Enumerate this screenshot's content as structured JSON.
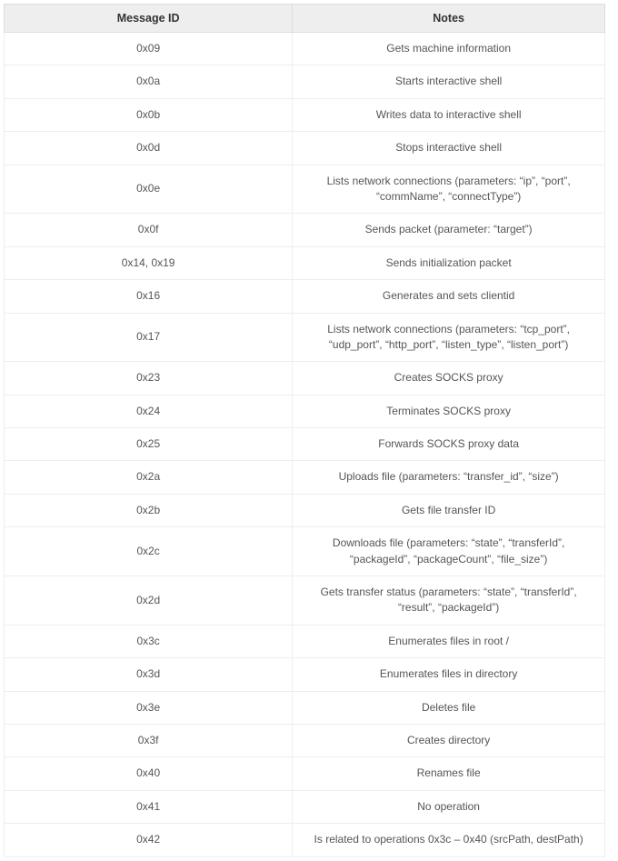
{
  "table": {
    "headers": {
      "id": "Message ID",
      "notes": "Notes"
    },
    "rows": [
      {
        "id": "0x09",
        "notes": "Gets machine information"
      },
      {
        "id": "0x0a",
        "notes": "Starts interactive shell"
      },
      {
        "id": "0x0b",
        "notes": "Writes data to interactive shell"
      },
      {
        "id": "0x0d",
        "notes": "Stops interactive shell"
      },
      {
        "id": "0x0e",
        "notes": "Lists network connections (parameters: “ip”, “port”, “commName”, “connectType”)"
      },
      {
        "id": "0x0f",
        "notes": "Sends packet (parameter: “target”)"
      },
      {
        "id": "0x14, 0x19",
        "notes": "Sends initialization packet"
      },
      {
        "id": "0x16",
        "notes": "Generates and sets clientid"
      },
      {
        "id": "0x17",
        "notes": "Lists network connections (parameters: “tcp_port”, “udp_port”, “http_port”, “listen_type”, “listen_port”)"
      },
      {
        "id": "0x23",
        "notes": "Creates SOCKS proxy"
      },
      {
        "id": "0x24",
        "notes": "Terminates SOCKS proxy"
      },
      {
        "id": "0x25",
        "notes": "Forwards SOCKS proxy data"
      },
      {
        "id": "0x2a",
        "notes": "Uploads file (parameters: “transfer_id”, “size”)"
      },
      {
        "id": "0x2b",
        "notes": "Gets file transfer ID"
      },
      {
        "id": "0x2c",
        "notes": "Downloads file (parameters: “state”, “transferId”, “packageId”, “packageCount”, “file_size”)"
      },
      {
        "id": "0x2d",
        "notes": "Gets transfer status (parameters: “state”, “transferId”, “result”, “packageId”)"
      },
      {
        "id": "0x3c",
        "notes": "Enumerates files in root /"
      },
      {
        "id": "0x3d",
        "notes": "Enumerates files in directory"
      },
      {
        "id": "0x3e",
        "notes": "Deletes file"
      },
      {
        "id": "0x3f",
        "notes": "Creates directory"
      },
      {
        "id": "0x40",
        "notes": "Renames file"
      },
      {
        "id": "0x41",
        "notes": "No operation"
      },
      {
        "id": "0x42",
        "notes": "Is related to operations 0x3c – 0x40 (srcPath, destPath)"
      }
    ]
  }
}
